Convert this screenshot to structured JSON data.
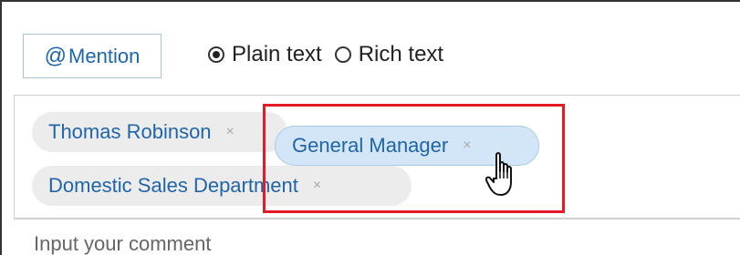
{
  "toolbar": {
    "mention_at": "@",
    "mention_label": "Mention",
    "format_options": [
      {
        "label": "Plain text",
        "checked": true
      },
      {
        "label": "Rich text",
        "checked": false
      }
    ]
  },
  "recipients": {
    "chips": [
      {
        "label": "Thomas Robinson",
        "remove": "×"
      },
      {
        "label": "Domestic Sales Department",
        "remove": "×"
      }
    ],
    "dragging_chip": {
      "label": "General Manager",
      "remove": "×"
    }
  },
  "comment": {
    "placeholder": "Input your comment"
  },
  "colors": {
    "link_blue": "#1f65a8",
    "highlight_red": "#e21b26",
    "chip_gray": "#ececec",
    "chip_drag_blue": "#d2e6f7"
  },
  "icons": {
    "cursor": "hand-pointer-icon",
    "remove": "close-icon"
  }
}
